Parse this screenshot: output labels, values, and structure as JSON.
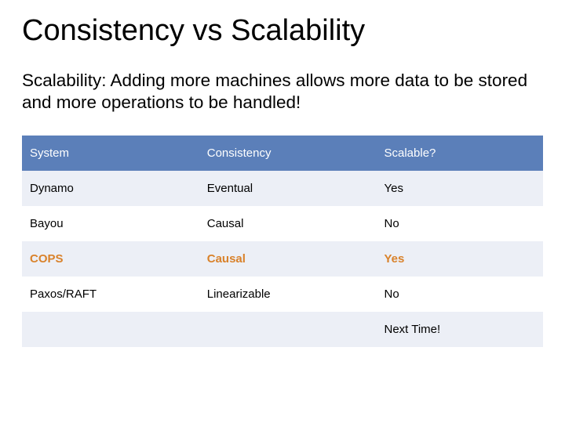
{
  "title": "Consistency vs Scalability",
  "subtitle": "Scalability: Adding more machines allows more data to be stored and more operations to be handled!",
  "table": {
    "headers": {
      "c1": "System",
      "c2": "Consistency",
      "c3": "Scalable?"
    },
    "rows": [
      {
        "c1": "Dynamo",
        "c2": "Eventual",
        "c3": "Yes",
        "highlight": false
      },
      {
        "c1": "Bayou",
        "c2": "Causal",
        "c3": "No",
        "highlight": false
      },
      {
        "c1": "COPS",
        "c2": "Causal",
        "c3": "Yes",
        "highlight": true
      },
      {
        "c1": "Paxos/RAFT",
        "c2": "Linearizable",
        "c3": "No",
        "highlight": false
      },
      {
        "c1": "",
        "c2": "",
        "c3": "Next Time!",
        "highlight": false
      }
    ]
  }
}
